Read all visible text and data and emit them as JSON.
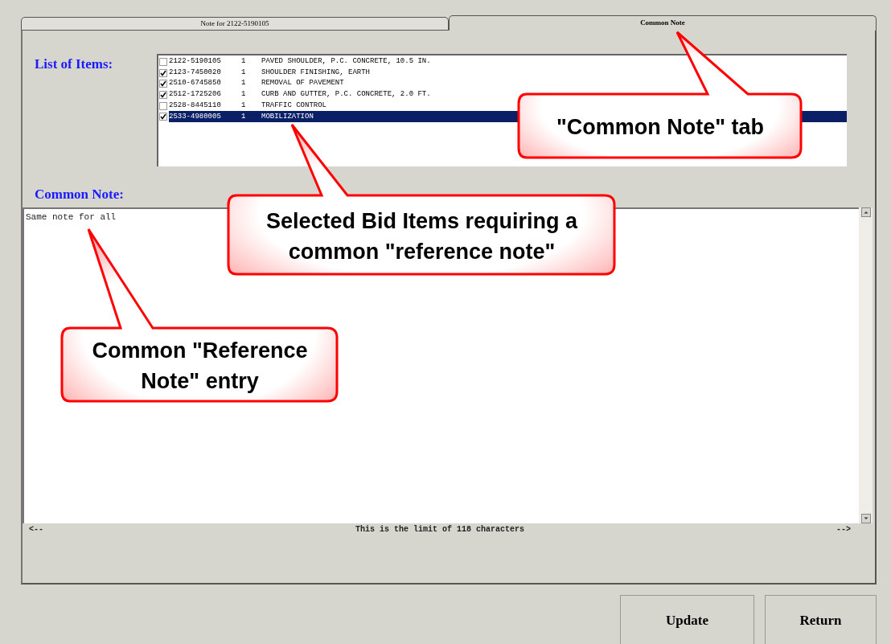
{
  "tabs": [
    {
      "label": "Note for 2122-5190105",
      "selected": false
    },
    {
      "label": "Common Note",
      "selected": true
    }
  ],
  "items_label": "List of Items:",
  "items": [
    {
      "code": "2122-5190105",
      "qty": "1",
      "description": "PAVED SHOULDER, P.C. CONCRETE, 10.5 IN.",
      "checked": false,
      "selected": false
    },
    {
      "code": "2123-7450020",
      "qty": "1",
      "description": "SHOULDER FINISHING, EARTH",
      "checked": true,
      "selected": false
    },
    {
      "code": "2510-6745850",
      "qty": "1",
      "description": "REMOVAL OF PAVEMENT",
      "checked": true,
      "selected": false
    },
    {
      "code": "2512-1725206",
      "qty": "1",
      "description": "CURB AND GUTTER, P.C. CONCRETE, 2.0 FT.",
      "checked": true,
      "selected": false
    },
    {
      "code": "2528-8445110",
      "qty": "1",
      "description": "TRAFFIC CONTROL",
      "checked": false,
      "selected": false
    },
    {
      "code": "2533-4980005",
      "qty": "1",
      "description": "MOBILIZATION",
      "checked": true,
      "selected": true
    }
  ],
  "note_label": "Common Note:",
  "note": {
    "value": "Same note for all"
  },
  "limit": {
    "left": "<--",
    "text": "This is the limit of 118 characters",
    "right": "-->"
  },
  "buttons": [
    "Update",
    "Return"
  ],
  "callouts": [
    "\"Common Note\" tab",
    "Selected Bid Items requiring a common \"reference note\"",
    "Common \"Reference Note\" entry"
  ]
}
